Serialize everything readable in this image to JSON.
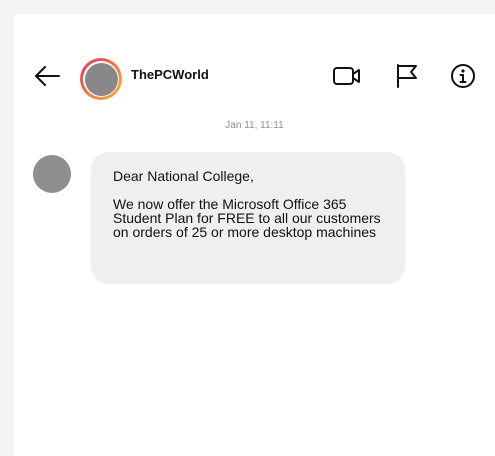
{
  "header": {
    "username": "ThePCWorld"
  },
  "conversation": {
    "timestamp": "Jan 11, 11:11",
    "messages": [
      {
        "greeting": "Dear National College,",
        "body": "We now offer the Microsoft Office 365 Student Plan for FREE to all our customers on orders of 25 or more desktop machines"
      }
    ]
  },
  "icons": {
    "back": "arrow-left-icon",
    "video": "video-camera-icon",
    "report": "flag-icon",
    "info": "info-icon"
  },
  "colors": {
    "avatar_ring": "#e1306c",
    "bubble_bg": "#efefef",
    "avatar_placeholder": "#8e8e8e"
  }
}
